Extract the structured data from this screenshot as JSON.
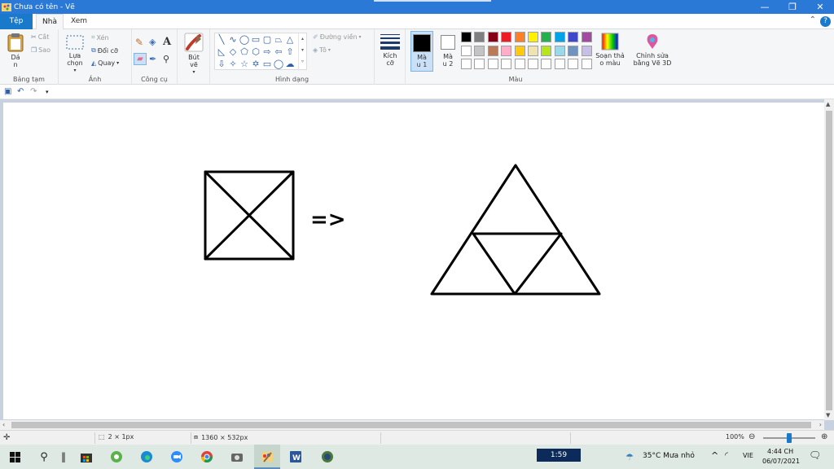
{
  "window": {
    "title": "Chưa có tên - Vẽ",
    "controls": [
      "—",
      "❐",
      "✕"
    ]
  },
  "tabs": {
    "file": "Tệp",
    "home": "Nhà",
    "view": "Xem",
    "help": "?"
  },
  "ribbon": {
    "clipboard": {
      "label": "Bảng tạm",
      "paste": "Dá\nn",
      "cut": "Cắt",
      "copy": "Sao"
    },
    "image": {
      "label": "Ảnh",
      "select": "Lựa\nchọn",
      "crop": "Xén",
      "resize": "Đổi cỡ",
      "rotate": "Quay"
    },
    "tools": {
      "label": "Công cụ"
    },
    "brushes": {
      "label": "Bút\nvẽ"
    },
    "shapes": {
      "label": "Hình dạng",
      "outline": "Đường viền",
      "fill": "Tô"
    },
    "size": {
      "label": "Kích\ncỡ"
    },
    "colors": {
      "label": "Màu",
      "color1": "Mà\nu 1",
      "color2": "Mà\nu 2",
      "edit_colors": "Soạn thả\no màu",
      "edit_paint3d": "Chỉnh sửa\nbằng Vẽ 3D",
      "palette_row1": [
        "#000000",
        "#7f7f7f",
        "#880015",
        "#ed1c24",
        "#ff7f27",
        "#fff200",
        "#22b14c",
        "#00a2e8",
        "#3f48cc",
        "#a349a4"
      ],
      "palette_row2": [
        "#ffffff",
        "#c3c3c3",
        "#b97a57",
        "#ffaec9",
        "#ffc90e",
        "#efe4b0",
        "#b5e61d",
        "#99d9ea",
        "#7092be",
        "#c8bfe7"
      ],
      "palette_row3": [
        "#ffffff",
        "#ffffff",
        "#ffffff",
        "#ffffff",
        "#ffffff",
        "#ffffff",
        "#ffffff",
        "#ffffff",
        "#ffffff",
        "#ffffff"
      ],
      "selected_color1": "#000000",
      "selected_color2": "#ffffff"
    }
  },
  "canvas": {
    "arrow_text": "=>"
  },
  "statusbar": {
    "selection_size": "2 × 1px",
    "image_size": "1360 × 532px",
    "zoom": "100%"
  },
  "taskbar": {
    "media_time": "1:59",
    "weather": "35°C  Mưa nhỏ",
    "language": "VIE",
    "time": "4:44 CH",
    "date": "06/07/2021"
  }
}
